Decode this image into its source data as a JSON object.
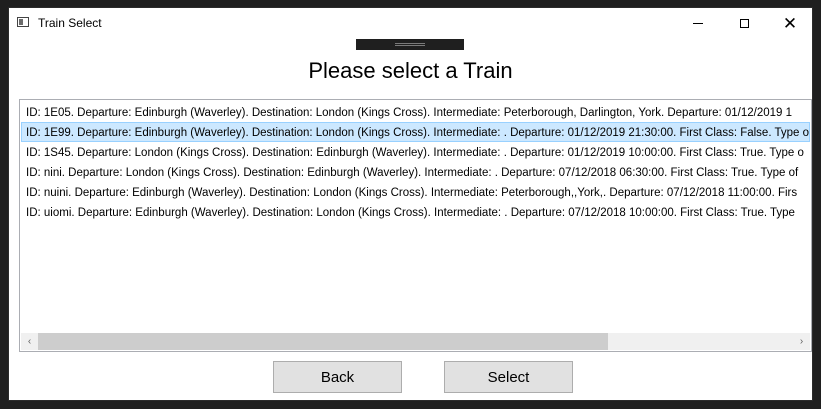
{
  "window": {
    "title": "Train Select",
    "close_glyph": "✕"
  },
  "heading": "Please select a Train",
  "trains": [
    "ID: 1E05. Departure: Edinburgh (Waverley). Destination: London (Kings Cross). Intermediate: Peterborough, Darlington, York. Departure: 01/12/2019 1",
    "ID: 1E99. Departure: Edinburgh (Waverley). Destination: London (Kings Cross). Intermediate: . Departure: 01/12/2019 21:30:00. First Class: False. Type o",
    "ID: 1S45. Departure: London (Kings Cross). Destination: Edinburgh (Waverley). Intermediate: . Departure: 01/12/2019 10:00:00. First Class: True. Type o",
    "ID: nini. Departure: London (Kings Cross). Destination: Edinburgh (Waverley). Intermediate: . Departure: 07/12/2018 06:30:00. First Class: True. Type of",
    "ID: nuini. Departure: Edinburgh (Waverley). Destination: London (Kings Cross). Intermediate: Peterborough,,York,. Departure: 07/12/2018 11:00:00. Firs",
    "ID: uiomi. Departure: Edinburgh (Waverley). Destination: London (Kings Cross). Intermediate: . Departure: 07/12/2018 10:00:00. First Class: True. Type"
  ],
  "selected_index": 1,
  "scrollbar": {
    "left_arrow": "‹",
    "right_arrow": "›"
  },
  "buttons": {
    "back": "Back",
    "select": "Select"
  }
}
